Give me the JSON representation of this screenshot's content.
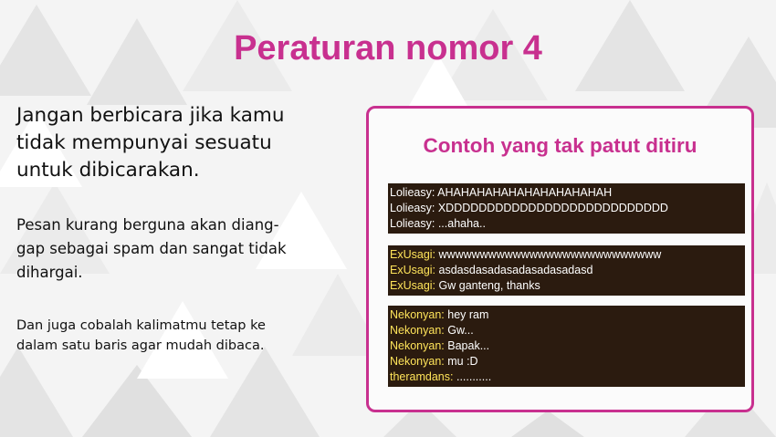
{
  "slide": {
    "title": "Peraturan nomor 4",
    "paragraphs": [
      "Jangan berbicara jika kamu\ntidak mempunyai sesuatu\nuntuk dibicarakan.",
      "Pesan kurang berguna akan diang-\ngap sebagai spam dan sangat tidak\ndihargai.",
      "Dan juga cobalah kalimatmu tetap ke\ndalam satu baris agar mudah dibaca."
    ]
  },
  "example": {
    "title": "Contoh yang tak patut ditiru",
    "chats": [
      {
        "name_color": "#ffffff",
        "lines": [
          {
            "name": "Lolieasy:",
            "text": "AHAHAHAHAHAHAHAHAHAHAH"
          },
          {
            "name": "Lolieasy:",
            "text": "XDDDDDDDDDDDDDDDDDDDDDDDDDDD"
          },
          {
            "name": "Lolieasy:",
            "text": "...ahaha.."
          }
        ]
      },
      {
        "name_color": "#ffe45a",
        "lines": [
          {
            "name": "ExUsagi:",
            "text": "wwwwwwwwwwwwwwwwwwwwwwwwwww"
          },
          {
            "name": "ExUsagi:",
            "text": "asdasdasadasadasadasadasd"
          },
          {
            "name": "ExUsagi:",
            "text": "Gw ganteng, thanks"
          }
        ]
      },
      {
        "name_color": "#ffe45a",
        "lines": [
          {
            "name": "Nekonyan:",
            "text": "hey ram"
          },
          {
            "name": "Nekonyan:",
            "text": "Gw..."
          },
          {
            "name": "Nekonyan:",
            "text": "Bapak..."
          },
          {
            "name": "Nekonyan:",
            "text": "mu :D"
          },
          {
            "name": "theramdans:",
            "text": "..........."
          }
        ]
      }
    ]
  }
}
